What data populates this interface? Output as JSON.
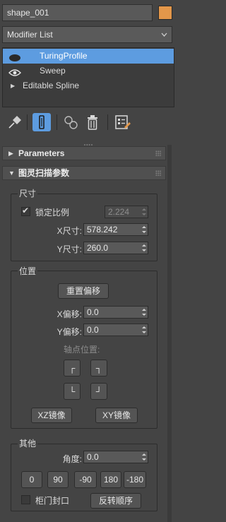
{
  "object": {
    "name": "shape_001",
    "color": "#e3974a"
  },
  "modifier_list": {
    "label": "Modifier List"
  },
  "stack": [
    {
      "label": "TuringProfile",
      "selected": true,
      "icon": "light-bulb-icon"
    },
    {
      "label": "Sweep",
      "selected": false,
      "icon": "eye-icon"
    },
    {
      "label": "Editable Spline",
      "selected": false,
      "icon": "expand-triangle-icon"
    }
  ],
  "toolbar": [
    {
      "name": "pin-stack-icon"
    },
    {
      "name": "show-end-result-icon",
      "active": true
    },
    {
      "name": "make-unique-icon"
    },
    {
      "name": "remove-modifier-icon"
    },
    {
      "name": "configure-modifier-sets-icon"
    }
  ],
  "rollouts": {
    "parameters": "Parameters",
    "turing": "图灵扫描参数"
  },
  "size": {
    "title": "尺寸",
    "lock_label": "锁定比例",
    "lock_checked": true,
    "ratio": "2.224",
    "x_label": "X尺寸:",
    "x_value": "578.242",
    "y_label": "Y尺寸:",
    "y_value": "260.0"
  },
  "position": {
    "title": "位置",
    "reset_label": "重置偏移",
    "x_label": "X偏移:",
    "x_value": "0.0",
    "y_label": "Y偏移:",
    "y_value": "0.0",
    "pivot_label": "轴点位置:",
    "corners": [
      "┌",
      "┐",
      "└",
      "┘"
    ],
    "xz_label": "XZ镜像",
    "xy_label": "XY镜像"
  },
  "other": {
    "title": "其他",
    "angle_label": "角度:",
    "angle_value": "0.0",
    "angles": [
      "0",
      "90",
      "-90",
      "180",
      "-180"
    ],
    "cap_label": "柜门封口",
    "cap_checked": false,
    "reverse_label": "反转顺序"
  }
}
